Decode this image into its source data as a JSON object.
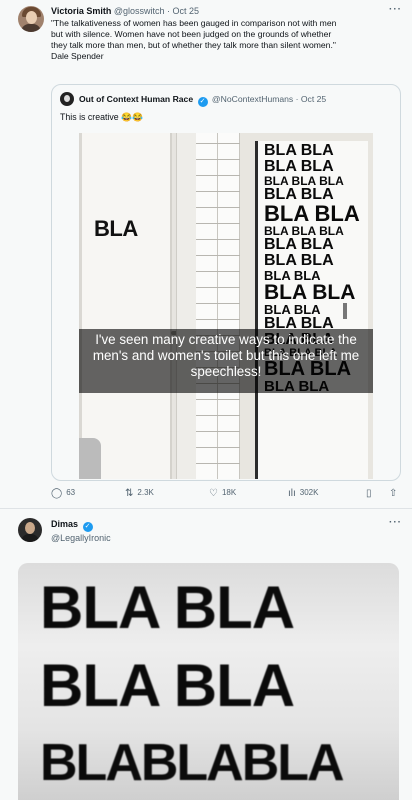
{
  "post1": {
    "author_name": "Victoria Smith",
    "handle_time": "@glosswitch · Oct 25",
    "more": "···",
    "text_lines": [
      "\"The talkativeness of women has been gauged in comparison not with men",
      "but with silence. Women have not been judged on the grounds of whether",
      "they talk more than men, but of whether they talk more than silent women.\"",
      "Dale Spender"
    ],
    "quote": {
      "author_name": "Out of Context Human Race",
      "handle_time": "@NoContextHumans · Oct 25",
      "text": "This is creative 😂😂",
      "photo": {
        "left_door_label": "BLA",
        "right_door_rows": [
          [
            "BLA BLA",
            16
          ],
          [
            "BLA BLA",
            16
          ],
          [
            "BLA BLA BLA",
            12
          ],
          [
            "BLA BLA",
            16
          ],
          [
            "BLA BLA",
            22
          ],
          [
            "BLA BLA BLA",
            12
          ],
          [
            "BLA BLA",
            16
          ],
          [
            "BLA BLA",
            16
          ],
          [
            "BLA BLA",
            13
          ],
          [
            "BLA BLA",
            21
          ],
          [
            "BLA BLA",
            13
          ],
          [
            "BLA BLA",
            16
          ],
          [
            "BLA BLA",
            16
          ],
          [
            "BLA BLA BLA",
            11
          ],
          [
            "BLA BLA",
            20
          ],
          [
            "BLA BLA",
            15
          ]
        ],
        "caption": "I've seen many creative ways to indicate the men's and women's toilet but this one left me speechless!"
      }
    },
    "actions": {
      "replies": "63",
      "reposts": "2.3K",
      "likes": "18K",
      "views": "302K"
    }
  },
  "post2": {
    "author_name": "Dimas",
    "handle": "@LegallyIronic",
    "more": "···",
    "image_rows": [
      "BLA BLA",
      "BLA BLA",
      "BLABLABLA"
    ]
  },
  "icons": {
    "reply": "reply-icon",
    "repost": "repost-icon",
    "like": "heart-icon",
    "views": "views-icon",
    "bookmark": "bookmark-icon",
    "share": "share-icon",
    "verified": "verified-badge-icon"
  },
  "colors": {
    "background": "#f7f9f9",
    "secondary_text": "#536471",
    "verified": "#1d9bf0",
    "border": "#cfd9de"
  }
}
